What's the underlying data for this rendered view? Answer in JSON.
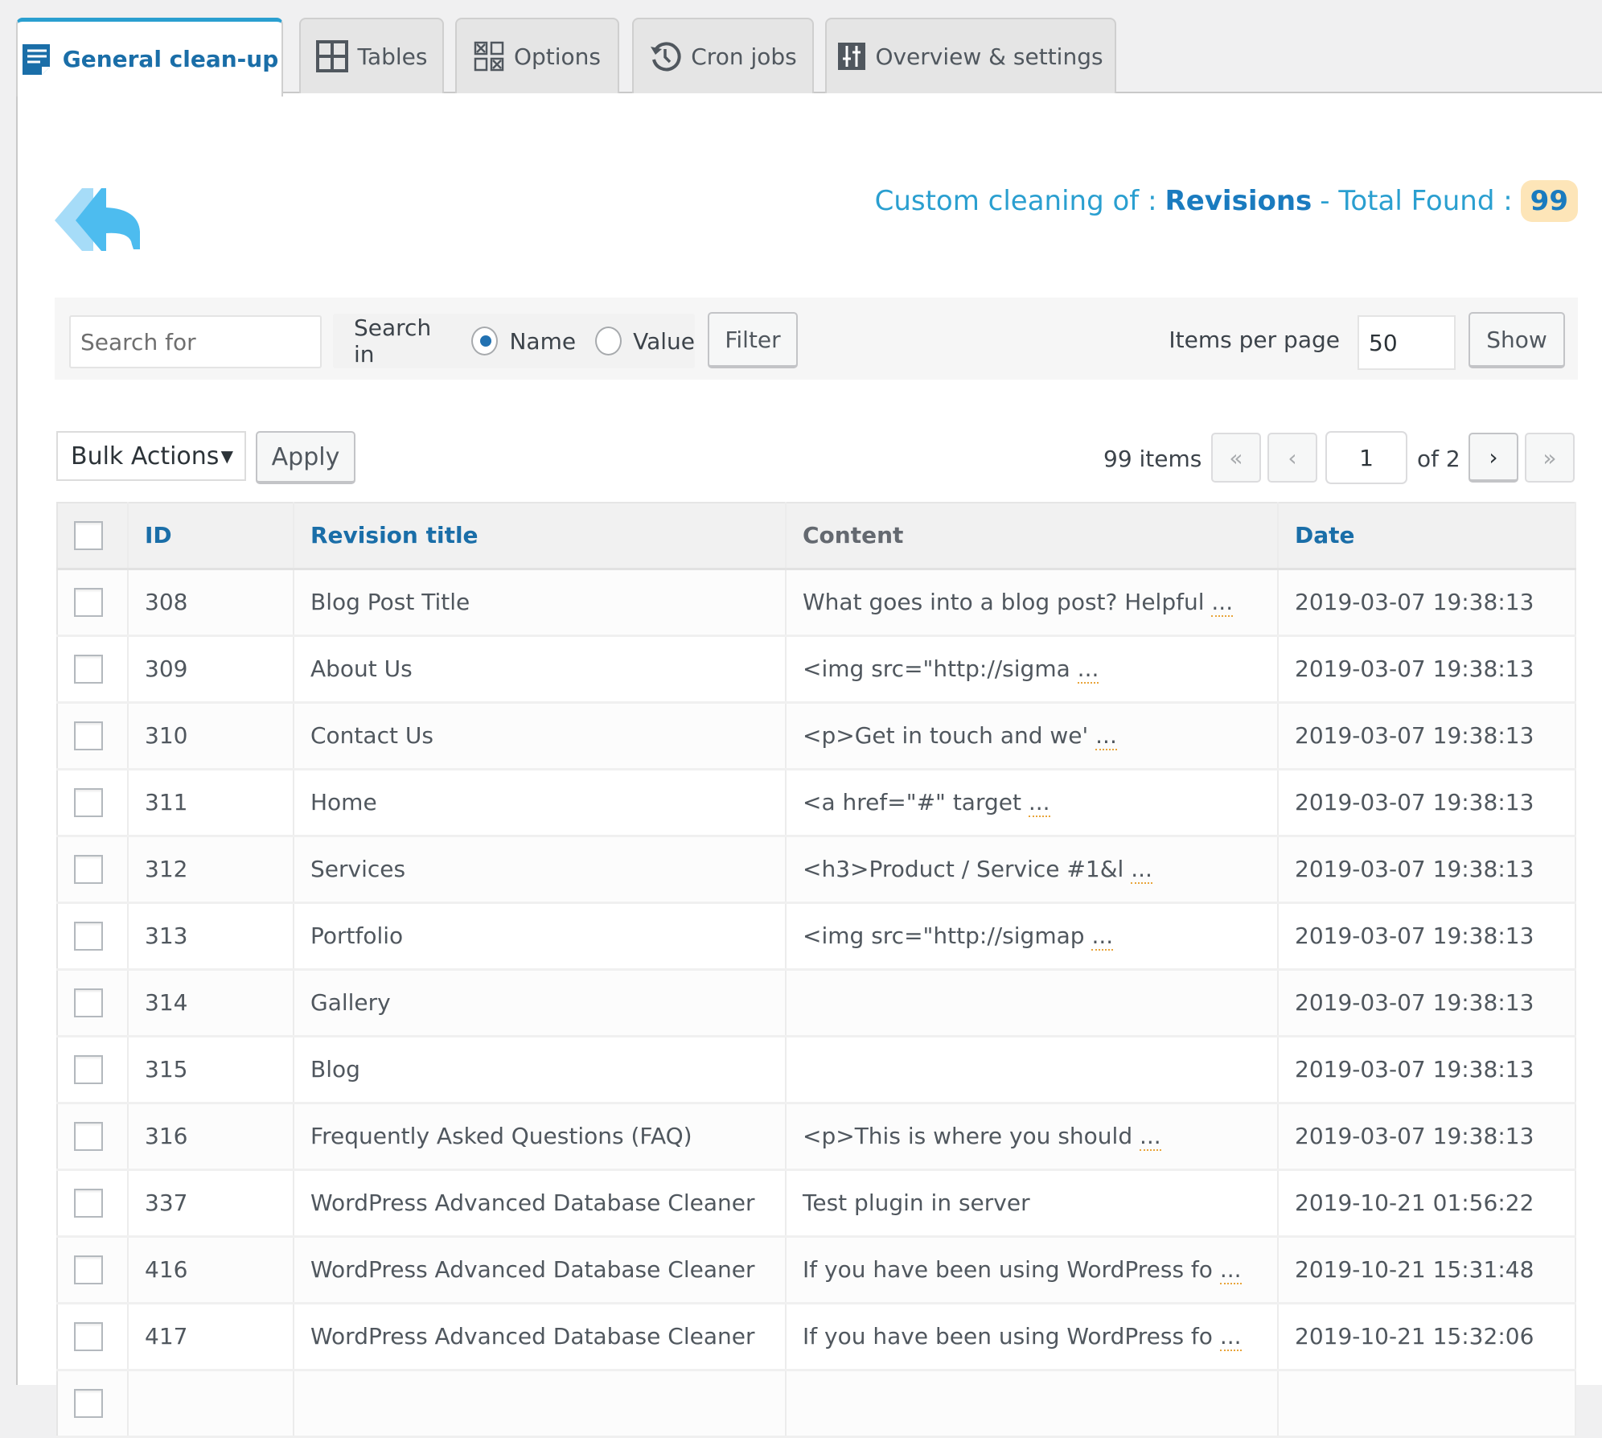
{
  "tabs": [
    {
      "label": "General clean-up",
      "icon": "document-icon",
      "active": true
    },
    {
      "label": "Tables",
      "icon": "grid-icon",
      "active": false
    },
    {
      "label": "Options",
      "icon": "checkbox-grid-icon",
      "active": false
    },
    {
      "label": "Cron jobs",
      "icon": "history-clock-icon",
      "active": false
    },
    {
      "label": "Overview & settings",
      "icon": "sliders-icon",
      "active": false
    }
  ],
  "header": {
    "prefix": "Custom cleaning of :",
    "item_type": "Revisions",
    "total_label": "- Total Found :",
    "total_count": "99"
  },
  "filter": {
    "search_placeholder": "Search for",
    "search_value": "",
    "search_in_label": "Search in",
    "options": [
      "Name",
      "Value"
    ],
    "selected_option": "Name",
    "filter_button": "Filter",
    "items_per_page_label": "Items per page",
    "items_per_page_value": "50",
    "show_button": "Show"
  },
  "bulk": {
    "selected": "Bulk Actions",
    "apply_button": "Apply"
  },
  "pagination": {
    "items_count": "99 items",
    "first": "«",
    "prev": "‹",
    "current_page": "1",
    "of_label": "of 2",
    "next": "›",
    "last": "»"
  },
  "table": {
    "columns": [
      "ID",
      "Revision title",
      "Content",
      "Date"
    ],
    "ellipsis": "...",
    "rows": [
      {
        "id": "308",
        "title": "Blog Post Title",
        "content": "What goes into a blog post? Helpful",
        "truncated": true,
        "date": "2019-03-07 19:38:13"
      },
      {
        "id": "309",
        "title": "About Us",
        "content": "<img src=\"http://sigma",
        "truncated": true,
        "date": "2019-03-07 19:38:13"
      },
      {
        "id": "310",
        "title": "Contact Us",
        "content": "<p>Get in touch and we'",
        "truncated": true,
        "date": "2019-03-07 19:38:13"
      },
      {
        "id": "311",
        "title": "Home",
        "content": "<a href=\"#\" target",
        "truncated": true,
        "date": "2019-03-07 19:38:13"
      },
      {
        "id": "312",
        "title": "Services",
        "content": "<h3>Product / Service #1&l",
        "truncated": true,
        "date": "2019-03-07 19:38:13"
      },
      {
        "id": "313",
        "title": "Portfolio",
        "content": "<img src=\"http://sigmap",
        "truncated": true,
        "date": "2019-03-07 19:38:13"
      },
      {
        "id": "314",
        "title": "Gallery",
        "content": "",
        "truncated": false,
        "date": "2019-03-07 19:38:13"
      },
      {
        "id": "315",
        "title": "Blog",
        "content": "",
        "truncated": false,
        "date": "2019-03-07 19:38:13"
      },
      {
        "id": "316",
        "title": "Frequently Asked Questions (FAQ)",
        "content": "<p>This is where you should",
        "truncated": true,
        "date": "2019-03-07 19:38:13"
      },
      {
        "id": "337",
        "title": "WordPress Advanced Database Cleaner",
        "content": "Test plugin in server",
        "truncated": false,
        "date": "2019-10-21 01:56:22"
      },
      {
        "id": "416",
        "title": "WordPress Advanced Database Cleaner",
        "content": "If you have been using WordPress fo",
        "truncated": true,
        "date": "2019-10-21 15:31:48"
      },
      {
        "id": "417",
        "title": "WordPress Advanced Database Cleaner",
        "content": "If you have been using WordPress fo",
        "truncated": true,
        "date": "2019-10-21 15:32:06"
      },
      {
        "id": "",
        "title": "",
        "content": "",
        "truncated": false,
        "date": ""
      }
    ]
  },
  "colors": {
    "accent": "#2a9fd0",
    "link": "#1a6ea8",
    "badge_bg": "#fde5b8"
  }
}
